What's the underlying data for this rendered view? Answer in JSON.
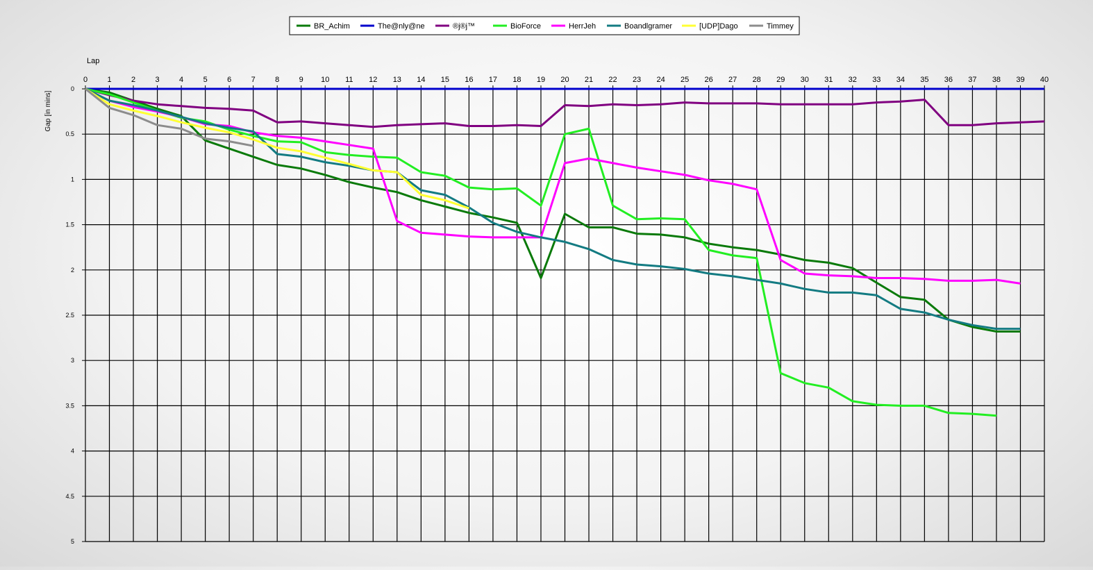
{
  "chart_data": {
    "type": "line",
    "title": "",
    "xlabel": "Lap",
    "ylabel": "Gap [in mins]",
    "xlim": [
      0,
      40
    ],
    "ylim": [
      0,
      5
    ],
    "y_inverted": true,
    "x_axis_position": "top",
    "x_ticks": [
      0,
      1,
      2,
      3,
      4,
      5,
      6,
      7,
      8,
      9,
      10,
      11,
      12,
      13,
      14,
      15,
      16,
      17,
      18,
      19,
      20,
      21,
      22,
      23,
      24,
      25,
      26,
      27,
      28,
      29,
      30,
      31,
      32,
      33,
      34,
      35,
      36,
      37,
      38,
      39,
      40
    ],
    "y_ticks": [
      0,
      0.5,
      1,
      1.5,
      2,
      2.5,
      3,
      3.5,
      4,
      4.5,
      5
    ],
    "y_tick_labels": [
      "0",
      "0.5",
      "1",
      "1.5",
      "2",
      "2.5",
      "3",
      "3.5",
      "4",
      "4.5",
      "5"
    ],
    "grid": true,
    "legend_position": "top-center",
    "series": [
      {
        "name": "BR_Achim",
        "color": "#0a7a0a",
        "x": [
          0,
          1,
          2,
          3,
          4,
          5,
          6,
          7,
          8,
          9,
          10,
          11,
          12,
          13,
          14,
          15,
          16,
          17,
          18,
          19,
          20,
          21,
          22,
          23,
          24,
          25,
          26,
          27,
          28,
          29,
          30,
          31,
          32,
          33,
          34,
          35,
          36,
          37,
          38,
          39
        ],
        "y": [
          0,
          0.04,
          0.13,
          0.22,
          0.3,
          0.57,
          0.66,
          0.75,
          0.84,
          0.88,
          0.95,
          1.03,
          1.09,
          1.14,
          1.23,
          1.3,
          1.37,
          1.42,
          1.48,
          2.09,
          1.38,
          1.53,
          1.53,
          1.6,
          1.61,
          1.64,
          1.71,
          1.75,
          1.78,
          1.83,
          1.89,
          1.92,
          1.98,
          2.14,
          2.3,
          2.33,
          2.55,
          2.63,
          2.68,
          2.68
        ]
      },
      {
        "name": "The@nly@ne",
        "color": "#0000cc",
        "x": [
          0,
          40
        ],
        "y": [
          0,
          0
        ]
      },
      {
        "name": "®j®j™",
        "color": "#800080",
        "x": [
          0,
          1,
          2,
          3,
          4,
          5,
          6,
          7,
          8,
          9,
          10,
          11,
          12,
          13,
          14,
          15,
          16,
          17,
          18,
          19,
          20,
          21,
          22,
          23,
          24,
          25,
          26,
          27,
          28,
          29,
          30,
          31,
          32,
          33,
          34,
          35,
          36,
          37,
          38,
          39,
          40
        ],
        "y": [
          0,
          0.07,
          0.13,
          0.17,
          0.19,
          0.21,
          0.22,
          0.24,
          0.37,
          0.36,
          0.38,
          0.4,
          0.42,
          0.4,
          0.39,
          0.38,
          0.41,
          0.41,
          0.4,
          0.41,
          0.18,
          0.19,
          0.17,
          0.18,
          0.17,
          0.15,
          0.16,
          0.16,
          0.16,
          0.17,
          0.17,
          0.17,
          0.17,
          0.15,
          0.14,
          0.12,
          0.4,
          0.4,
          0.38,
          0.37,
          0.36
        ]
      },
      {
        "name": "BioForce",
        "color": "#22ee22",
        "x": [
          0,
          1,
          2,
          3,
          4,
          5,
          6,
          7,
          8,
          9,
          10,
          11,
          12,
          13,
          14,
          15,
          16,
          17,
          18,
          19,
          20,
          21,
          22,
          23,
          24,
          25,
          26,
          27,
          28,
          29,
          30,
          31,
          32,
          33,
          34,
          35,
          36,
          37,
          38
        ],
        "y": [
          0,
          0.06,
          0.15,
          0.24,
          0.32,
          0.36,
          0.45,
          0.52,
          0.58,
          0.59,
          0.7,
          0.73,
          0.75,
          0.76,
          0.92,
          0.96,
          1.09,
          1.11,
          1.1,
          1.29,
          0.5,
          0.44,
          1.29,
          1.44,
          1.43,
          1.44,
          1.78,
          1.84,
          1.87,
          3.14,
          3.25,
          3.3,
          3.45,
          3.49,
          3.5,
          3.5,
          3.58,
          3.59,
          3.61
        ]
      },
      {
        "name": "HerrJeh",
        "color": "#ff00ff",
        "x": [
          0,
          1,
          2,
          3,
          4,
          5,
          6,
          7,
          8,
          9,
          10,
          11,
          12,
          13,
          14,
          15,
          16,
          17,
          18,
          19,
          20,
          21,
          22,
          23,
          24,
          25,
          26,
          27,
          28,
          29,
          30,
          31,
          32,
          33,
          34,
          35,
          36,
          37,
          38,
          39
        ],
        "y": [
          0,
          0.13,
          0.2,
          0.25,
          0.31,
          0.39,
          0.41,
          0.48,
          0.52,
          0.54,
          0.58,
          0.62,
          0.66,
          1.46,
          1.59,
          1.61,
          1.63,
          1.64,
          1.64,
          1.64,
          0.82,
          0.77,
          0.82,
          0.87,
          0.91,
          0.95,
          1.01,
          1.05,
          1.11,
          1.89,
          2.04,
          2.06,
          2.07,
          2.09,
          2.09,
          2.1,
          2.12,
          2.12,
          2.11,
          2.15
        ]
      },
      {
        "name": "Boandlgramer",
        "color": "#137b82",
        "x": [
          0,
          1,
          2,
          3,
          4,
          5,
          6,
          7,
          8,
          9,
          10,
          11,
          12,
          13,
          14,
          15,
          16,
          17,
          18,
          19,
          20,
          21,
          22,
          23,
          24,
          25,
          26,
          27,
          28,
          29,
          30,
          31,
          32,
          33,
          34,
          35,
          36,
          37,
          38,
          39
        ],
        "y": [
          0,
          0.13,
          0.18,
          0.24,
          0.31,
          0.38,
          0.43,
          0.47,
          0.72,
          0.75,
          0.81,
          0.85,
          0.9,
          0.92,
          1.12,
          1.17,
          1.31,
          1.48,
          1.58,
          1.64,
          1.69,
          1.77,
          1.89,
          1.94,
          1.96,
          1.99,
          2.04,
          2.07,
          2.11,
          2.15,
          2.21,
          2.25,
          2.25,
          2.28,
          2.43,
          2.47,
          2.55,
          2.61,
          2.65,
          2.65
        ]
      },
      {
        "name": "[UDP]Dago",
        "color": "#ffff33",
        "x": [
          0,
          1,
          2,
          3,
          4,
          5,
          6,
          7,
          8,
          9,
          10,
          11,
          12,
          13,
          14,
          15,
          16
        ],
        "y": [
          0,
          0.17,
          0.24,
          0.3,
          0.37,
          0.43,
          0.48,
          0.56,
          0.65,
          0.69,
          0.76,
          0.83,
          0.9,
          0.92,
          1.17,
          1.23,
          1.32
        ]
      },
      {
        "name": "Timmey",
        "color": "#8c8c8c",
        "x": [
          0,
          1,
          2,
          3,
          4,
          5,
          6,
          7
        ],
        "y": [
          0,
          0.21,
          0.29,
          0.4,
          0.44,
          0.55,
          0.58,
          0.63
        ]
      }
    ]
  }
}
